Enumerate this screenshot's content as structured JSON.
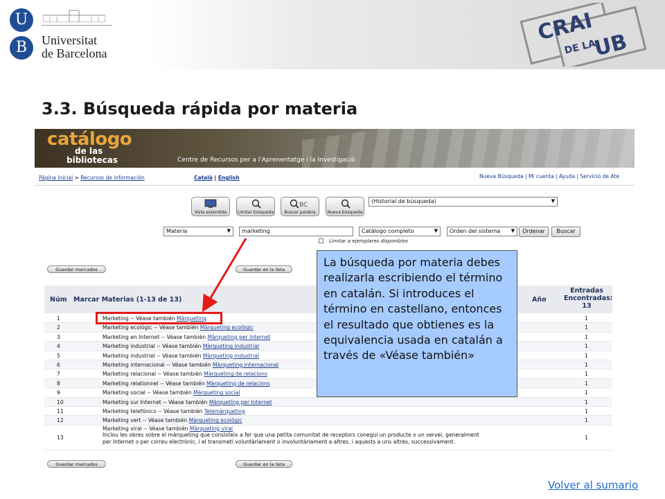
{
  "university": {
    "letter_top": "U",
    "letter_bottom": "B",
    "line1": "Universitat",
    "line2": "de Barcelona"
  },
  "crai_logo": {
    "text": "CRAI DE LA UB"
  },
  "page_title": "3.3. Búsqueda rápida por materia",
  "catalog": {
    "title": "catálogo",
    "subtitle1": "de las",
    "subtitle2": "bibliotecas",
    "centre": "Centre de Recursos per a l'Aprenentatge i la Investigació",
    "nav": {
      "home": "Página inicial",
      "sep": " > ",
      "resources": "Recursos de información",
      "lang_ca": "Català",
      "lang_sep": " | ",
      "lang_en": "English",
      "right": "Nueva Búsqueda  |  Mi cuenta  |  Ayuda  |  Servicio de Ate"
    },
    "toolbar": {
      "vista": "Vista extendida",
      "limitar": "Limitar búsqueda",
      "buscar_palabra": "Buscar palabra",
      "nueva": "Nueva búsqueda",
      "historial": "(Historial de búsqueda)"
    },
    "search": {
      "field": "Materia",
      "term": "marketing",
      "scope": "Catálogo completo",
      "order": "Orden del sistema",
      "ordenar": "Ordenar",
      "buscar": "Buscar",
      "limit_label": "Limitar a ejemplares disponibles"
    },
    "guardar_marcados": "Guardar marcados",
    "guardar_lista": "Guardar en la lista",
    "results_header": {
      "num": "Núm",
      "marcar": "Marcar Materias (1-13 de 13)",
      "ano": "Año",
      "entradas": "Entradas Encontradas: 13"
    },
    "rows": [
      {
        "num": "1",
        "text": "Marketing -- Véase también ",
        "link": "Màrqueting ",
        "count": "1"
      },
      {
        "num": "2",
        "text": "Marketing ecològic -- Véase también ",
        "link": "Màrqueting ecològic ",
        "count": "1"
      },
      {
        "num": "3",
        "text": "Marketing en Internet -- Véase también ",
        "link": "Màrqueting per Internet ",
        "count": "1"
      },
      {
        "num": "4",
        "text": "Marketing industrial -- Véase también ",
        "link": "Màrqueting industrial ",
        "count": "1"
      },
      {
        "num": "5",
        "text": "Marketing industriel -- Véase también ",
        "link": "Màrqueting industrial ",
        "count": "1"
      },
      {
        "num": "6",
        "text": "Marketing internacional -- Véase también ",
        "link": "Màrqueting internacional ",
        "count": "1"
      },
      {
        "num": "7",
        "text": "Marketing relacional -- Véase también ",
        "link": "Màrqueting de relacions ",
        "count": "1"
      },
      {
        "num": "8",
        "text": "Marketing relationnel -- Véase también ",
        "link": "Màrqueting de relacions ",
        "count": "1"
      },
      {
        "num": "9",
        "text": "Marketing social -- Véase también ",
        "link": "Màrqueting social ",
        "count": "1"
      },
      {
        "num": "10",
        "text": "Marketing sur Internet -- Véase también ",
        "link": "Màrqueting per Internet ",
        "count": "1"
      },
      {
        "num": "11",
        "text": "Marketing telefónico -- Véase también ",
        "link": "Telemàrqueting ",
        "count": "1"
      },
      {
        "num": "12",
        "text": "Marketing vert -- Véase también ",
        "link": "Màrqueting ecològic ",
        "count": "1"
      },
      {
        "num": "13",
        "text": "Marketing viral -- Véase también ",
        "link": "Màrqueting viral ",
        "count": "1",
        "note1": "Inclou les obres sobre el màrqueting que consisteix a fer que una petita comunitat de receptors conegui un producte o un servei, generalment",
        "note2": "per Internet o per correu electrònic, i el transmeti voluntàriament o involuntàriament a altres, i aquests a uns altres, successivament."
      }
    ]
  },
  "note": {
    "text": "La búsqueda por materia debes realizarla escribiendo el término en catalán. Si introduces el término en castellano, entonces el resultado que obtienes es la equivalencia usada en catalán a través de «Véase también»"
  },
  "back_link": "Volver al sumario",
  "colors": {
    "title": "#1a1a1a",
    "note_bg": "#a6cbff",
    "highlight": "#e21a1a",
    "link": "#1f6cc9",
    "catalog_accent": "#e8a53c"
  },
  "icons": [
    "university-shield-icon",
    "crai-logo-icon",
    "search-magnifier-icon",
    "dropdown-arrow-icon",
    "checkbox-icon"
  ]
}
